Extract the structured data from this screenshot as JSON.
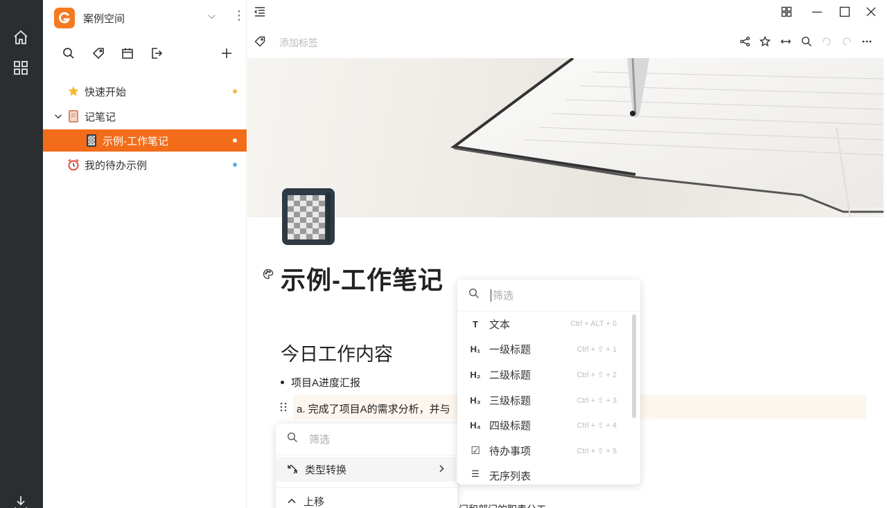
{
  "workspace": {
    "name": "案例空间",
    "accent": "#f47a20"
  },
  "tree": [
    {
      "label": "快速开始",
      "icon": "star-icon",
      "dot": "#f5b545"
    },
    {
      "label": "记笔记",
      "icon": "notebook-icon"
    },
    {
      "label": "示例-工作笔记",
      "icon": "notebook-dark-icon",
      "active": true,
      "dot": "#ffffff"
    },
    {
      "label": "我的待办示例",
      "icon": "alarm-clock-icon",
      "dot": "#5aaee6"
    }
  ],
  "tagbar": {
    "placeholder": "添加标签"
  },
  "document": {
    "title": "示例-工作笔记",
    "heading": "今日工作内容",
    "bullet": "项目A进度汇报",
    "line_a": "a. 完成了项目A的需求分析，并与",
    "cut_text": "门和部门的职责分工"
  },
  "block_menu": {
    "placeholder": "筛选",
    "items": [
      {
        "icon": "T",
        "label": "文本",
        "shortcut": "Ctrl + ALT + 0"
      },
      {
        "icon": "H₁",
        "label": "一级标题",
        "shortcut": "Ctrl + ⇧ + 1"
      },
      {
        "icon": "H₂",
        "label": "二级标题",
        "shortcut": "Ctrl + ⇧ + 2"
      },
      {
        "icon": "H₃",
        "label": "三级标题",
        "shortcut": "Ctrl + ⇧ + 3"
      },
      {
        "icon": "H₄",
        "label": "四级标题",
        "shortcut": "Ctrl + ⇧ + 4"
      },
      {
        "icon": "☑",
        "label": "待办事项",
        "shortcut": "Ctrl + ⇧ + 5"
      },
      {
        "icon": "☰",
        "label": "无序列表",
        "shortcut": ""
      }
    ]
  },
  "context_menu": {
    "placeholder": "筛选",
    "convert_label": "类型转换",
    "move_up_label": "上移"
  }
}
